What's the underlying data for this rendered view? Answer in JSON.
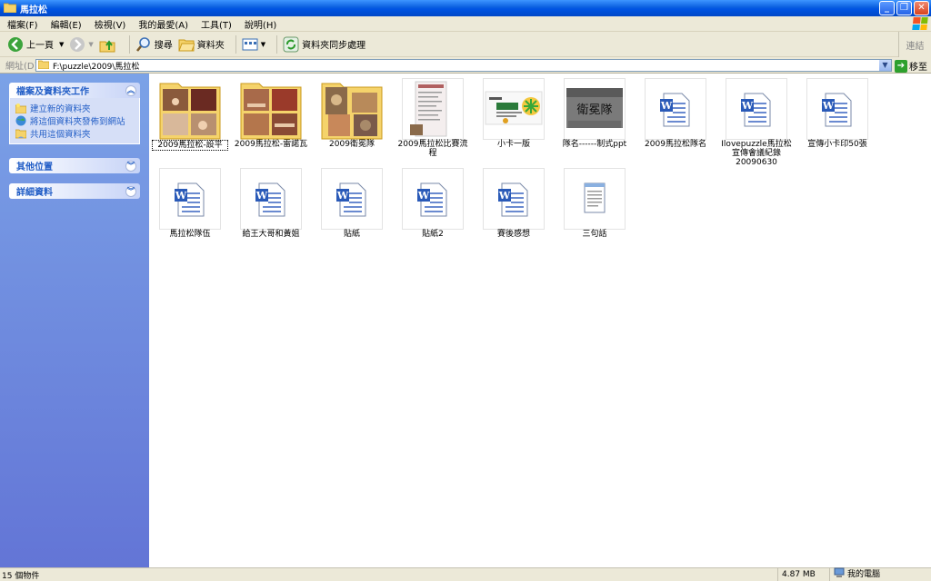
{
  "window": {
    "title": "馬拉松"
  },
  "menu": [
    "檔案(F)",
    "編輯(E)",
    "檢視(V)",
    "我的最愛(A)",
    "工具(T)",
    "說明(H)"
  ],
  "toolbar": {
    "back": "上一頁",
    "search": "搜尋",
    "folders": "資料夾",
    "sync": "資料夾同步處理",
    "links": "連結"
  },
  "address": {
    "label": "網址(D)",
    "value": "F:\\puzzle\\2009\\馬拉松",
    "go": "移至"
  },
  "sidebar": {
    "tasks": {
      "title": "檔案及資料夾工作",
      "items": [
        "建立新的資料夾",
        "將這個資料夾發佈到網站",
        "共用這個資料夾"
      ]
    },
    "other": {
      "title": "其他位置"
    },
    "details": {
      "title": "詳細資料"
    }
  },
  "files": [
    {
      "name": "2009馬拉松-設平",
      "type": "folder-photo"
    },
    {
      "name": "2009馬拉松-雷諾瓦",
      "type": "folder-photo"
    },
    {
      "name": "2009衛冕隊",
      "type": "folder-art"
    },
    {
      "name": "2009馬拉松比賽流程",
      "type": "doc-image"
    },
    {
      "name": "小卡一版",
      "type": "card-image"
    },
    {
      "name": "隊名------制式ppt",
      "type": "ppt-image"
    },
    {
      "name": "2009馬拉松隊名",
      "type": "word"
    },
    {
      "name": "Ilovepuzzle馬拉松宣傳會議紀錄20090630",
      "type": "word"
    },
    {
      "name": "宣傳小卡印50張",
      "type": "word"
    },
    {
      "name": "馬拉松隊伍",
      "type": "word"
    },
    {
      "name": "給王大哥和黃姐",
      "type": "word"
    },
    {
      "name": "貼紙",
      "type": "word"
    },
    {
      "name": "貼紙2",
      "type": "word"
    },
    {
      "name": "賽後感想",
      "type": "word"
    },
    {
      "name": "三句話",
      "type": "notepad"
    }
  ],
  "thumbtext": {
    "ppt": "衛冕隊"
  },
  "status": {
    "count": "15 個物件",
    "size": "4.87 MB",
    "location": "我的電腦"
  },
  "colors": {
    "titlebar": "#0054e3",
    "sidebar": "#6375d6",
    "link": "#215dc6"
  }
}
